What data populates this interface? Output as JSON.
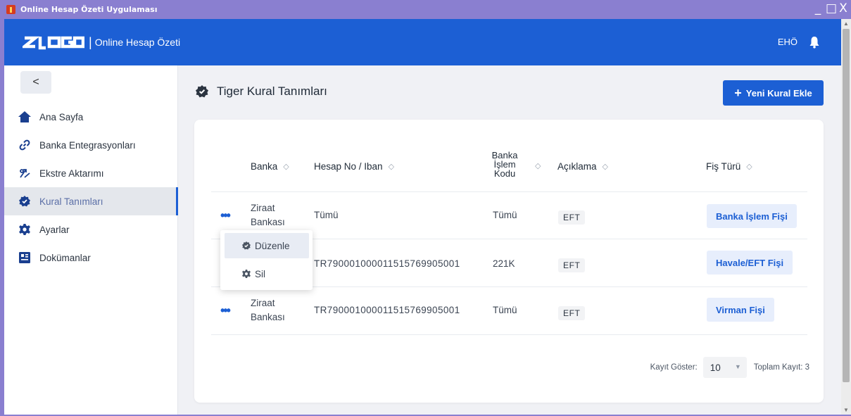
{
  "window": {
    "title": "Online Hesap Özeti Uygulaması",
    "controls": [
      "_",
      "□",
      "X"
    ]
  },
  "header": {
    "logo": "ELOGO",
    "app_name": "Online Hesap Özeti",
    "user_initials": "EHÖ"
  },
  "sidebar": {
    "back_label": "<",
    "items": [
      {
        "label": "Ana Sayfa",
        "icon": "home-icon"
      },
      {
        "label": "Banka Entegrasyonları",
        "icon": "link-icon"
      },
      {
        "label": "Ekstre Aktarımı",
        "icon": "transfer-icon"
      },
      {
        "label": "Kural Tanımları",
        "icon": "badge-check-icon",
        "active": true
      },
      {
        "label": "Ayarlar",
        "icon": "gear-icon"
      },
      {
        "label": "Dokümanlar",
        "icon": "document-icon"
      }
    ]
  },
  "page": {
    "title": "Tiger Kural Tanımları",
    "add_button": "Yeni Kural Ekle"
  },
  "table": {
    "headers": {
      "banka": "Banka",
      "hesap": "Hesap No / Iban",
      "islem_line1": "Banka",
      "islem_line2": "İşlem",
      "islem_line3": "Kodu",
      "aciklama": "Açıklama",
      "fis_turu": "Fiş Türü"
    },
    "rows": [
      {
        "banka1": "Ziraat",
        "banka2": "Bankası",
        "hesap": "Tümü",
        "islem": "Tümü",
        "aciklama": "EFT",
        "fis": "Banka İşlem Fişi"
      },
      {
        "banka1": "",
        "banka2": "",
        "hesap": "TR790001000011515769905001",
        "islem": "221K",
        "aciklama": "EFT",
        "fis": "Havale/EFT Fişi"
      },
      {
        "banka1": "Ziraat",
        "banka2": "Bankası",
        "hesap": "TR790001000011515769905001",
        "islem": "Tümü",
        "aciklama": "EFT",
        "fis": "Virman Fişi"
      }
    ]
  },
  "context_menu": {
    "edit": "Düzenle",
    "delete": "Sil"
  },
  "footer": {
    "page_size_label": "Kayıt Göster:",
    "page_size": "10",
    "total_label": "Toplam Kayıt: 3"
  },
  "colors": {
    "primary": "#1c5fd4",
    "titlebar": "#8a7fd0"
  }
}
